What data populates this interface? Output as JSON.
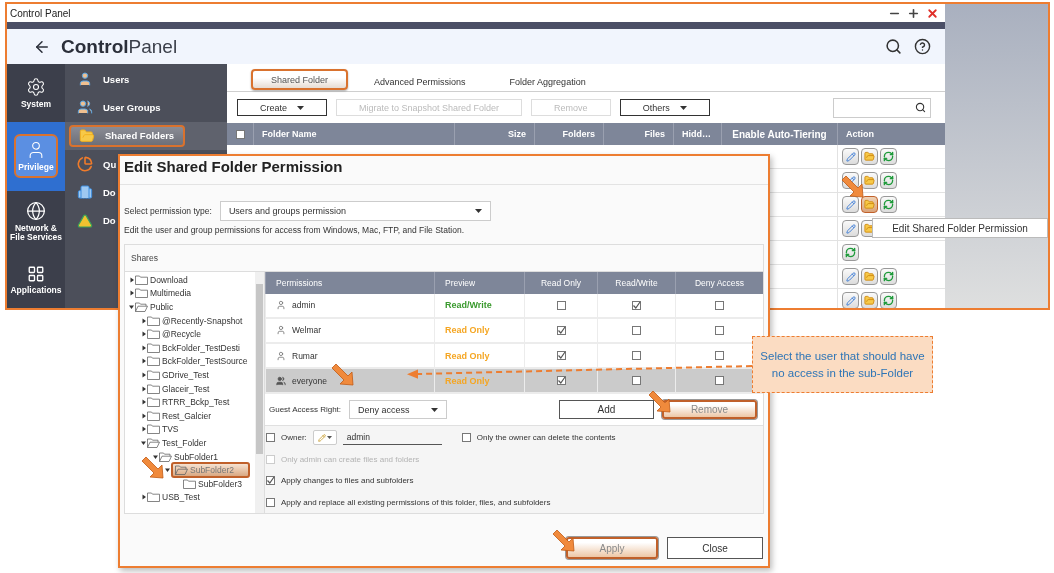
{
  "window": {
    "title": "Control Panel"
  },
  "header": {
    "title_bold": "Control",
    "title_light": "Panel"
  },
  "main_nav": [
    {
      "label": "System",
      "kind": "system",
      "selected": false
    },
    {
      "label": "Privilege",
      "kind": "privilege",
      "selected": true
    },
    {
      "label": "Network & File Services",
      "kind": "network",
      "selected": false
    },
    {
      "label": "Applications",
      "kind": "apps",
      "selected": false
    }
  ],
  "sub_nav": [
    {
      "label": "Users",
      "kind": "user",
      "selected": false
    },
    {
      "label": "User Groups",
      "kind": "group",
      "selected": false
    },
    {
      "label": "Shared Folders",
      "kind": "share",
      "selected": true
    },
    {
      "label": "Qu",
      "kind": "quota",
      "selected": false
    },
    {
      "label": "Do",
      "kind": "domain",
      "selected": false
    },
    {
      "label": "Do",
      "kind": "controller",
      "selected": false
    }
  ],
  "tabs": [
    {
      "label": "Shared Folder",
      "selected": true
    },
    {
      "label": "Advanced Permissions",
      "selected": false
    },
    {
      "label": "Folder Aggregation",
      "selected": false
    }
  ],
  "toolbar": [
    {
      "label": "Create",
      "dropdown": true,
      "disabled": false
    },
    {
      "label": "Migrate to Snapshot Shared Folder",
      "dropdown": false,
      "disabled": true
    },
    {
      "label": "Remove",
      "dropdown": false,
      "disabled": true
    },
    {
      "label": "Others",
      "dropdown": true,
      "disabled": false
    }
  ],
  "table": {
    "select_all_checked": false,
    "columns": [
      "Folder Name",
      "Size",
      "Folders",
      "Files",
      "Hidd…",
      "Enable Auto-Tiering",
      "Action"
    ],
    "rows": [
      {
        "actions": [
          {
            "kind": "edit",
            "highlighted": false
          },
          {
            "kind": "permission",
            "highlighted": false
          },
          {
            "kind": "refresh",
            "highlighted": false
          }
        ]
      },
      {
        "actions": [
          {
            "kind": "edit",
            "highlighted": false
          },
          {
            "kind": "permission",
            "highlighted": false
          },
          {
            "kind": "refresh",
            "highlighted": false
          }
        ]
      },
      {
        "actions": [
          {
            "kind": "edit",
            "highlighted": false
          },
          {
            "kind": "permission",
            "highlighted": true
          },
          {
            "kind": "refresh",
            "highlighted": false
          }
        ]
      },
      {
        "actions": [
          {
            "kind": "edit",
            "highlighted": false
          },
          {
            "kind": "permission",
            "highlighted": false
          }
        ]
      },
      {
        "actions": [
          {
            "kind": "refresh",
            "highlighted": false
          }
        ]
      },
      {
        "actions": [
          {
            "kind": "edit",
            "highlighted": false
          },
          {
            "kind": "permission",
            "highlighted": false
          },
          {
            "kind": "refresh",
            "highlighted": false
          }
        ]
      },
      {
        "actions": [
          {
            "kind": "edit",
            "highlighted": false
          },
          {
            "kind": "permission",
            "highlighted": false
          },
          {
            "kind": "refresh",
            "highlighted": false
          }
        ]
      }
    ]
  },
  "tooltip": "Edit Shared Folder Permission",
  "dialog": {
    "title": "Edit Shared Folder Permission",
    "permission_type": {
      "label": "Select permission type:",
      "value": "Users and groups permission"
    },
    "description": "Edit the user and group permissions for access from Windows, Mac, FTP, and File Station.",
    "shares_label": "Shares",
    "tree": [
      {
        "label": "Download",
        "expanded": false,
        "selected": false
      },
      {
        "label": "Multimedia",
        "expanded": false,
        "selected": false
      },
      {
        "label": "Public",
        "expanded": true,
        "selected": false,
        "children": [
          {
            "label": "@Recently-Snapshot",
            "expanded": false,
            "selected": false
          },
          {
            "label": "@Recycle",
            "expanded": false,
            "selected": false
          },
          {
            "label": "BckFolder_TestDesti",
            "expanded": false,
            "selected": false
          },
          {
            "label": "BckFolder_TestSource",
            "expanded": false,
            "selected": false
          },
          {
            "label": "GDrive_Test",
            "expanded": false,
            "selected": false
          },
          {
            "label": "Glaceir_Test",
            "expanded": false,
            "selected": false
          },
          {
            "label": "RTRR_Bckp_Test",
            "expanded": false,
            "selected": false
          },
          {
            "label": "Rest_Galcier",
            "expanded": false,
            "selected": false
          },
          {
            "label": "TVS",
            "expanded": false,
            "selected": false
          },
          {
            "label": "Test_Folder",
            "expanded": true,
            "selected": false,
            "children": [
              {
                "label": "SubFolder1",
                "expanded": true,
                "selected": false,
                "children": [
                  {
                    "label": "SubFolder2",
                    "expanded": true,
                    "selected": true,
                    "children": [
                      {
                        "label": "SubFolder3",
                        "selected": false
                      }
                    ]
                  }
                ]
              }
            ]
          },
          {
            "label": "USB_Test",
            "expanded": false,
            "selected": false
          }
        ]
      }
    ],
    "permissions": {
      "columns": [
        "Permissions",
        "Preview",
        "Read Only",
        "Read/Write",
        "Deny Access"
      ],
      "rows": [
        {
          "name": "admin",
          "kind": "user",
          "preview": "Read/Write",
          "color": "#3a9a2e",
          "read_only": false,
          "read_write": true,
          "deny_access": false,
          "selected": false
        },
        {
          "name": "Welmar",
          "kind": "user",
          "preview": "Read Only",
          "color": "#f5a623",
          "read_only": true,
          "read_write": false,
          "deny_access": false,
          "selected": false
        },
        {
          "name": "Rumar",
          "kind": "user",
          "preview": "Read Only",
          "color": "#f5a623",
          "read_only": true,
          "read_write": false,
          "deny_access": false,
          "selected": false
        },
        {
          "name": "everyone",
          "kind": "group",
          "preview": "Read Only",
          "color": "#f5a623",
          "read_only": true,
          "read_write": false,
          "deny_access": false,
          "selected": true
        }
      ]
    },
    "guest_access": {
      "label": "Guest Access Right:",
      "value": "Deny access"
    },
    "row_buttons": [
      {
        "label": "Add",
        "highlighted": false
      },
      {
        "label": "Remove",
        "highlighted": true
      }
    ],
    "owner": {
      "label": "Owner:",
      "value": "admin",
      "checked": false
    },
    "owner_delete": {
      "label": "Only the owner can delete the contents",
      "checked": false
    },
    "options": [
      {
        "label": "Only admin can create files and folders",
        "checked": false,
        "disabled": true
      },
      {
        "label": "Apply changes to files and subfolders",
        "checked": true,
        "disabled": false
      },
      {
        "label": "Apply and replace all existing permissions of this folder, files, and subfolders",
        "checked": false,
        "disabled": false
      }
    ],
    "footer_buttons": [
      {
        "label": "Apply",
        "highlighted": true
      },
      {
        "label": "Close",
        "highlighted": false
      }
    ]
  },
  "callout": "Select the user that should have no access in the sub-Folder"
}
